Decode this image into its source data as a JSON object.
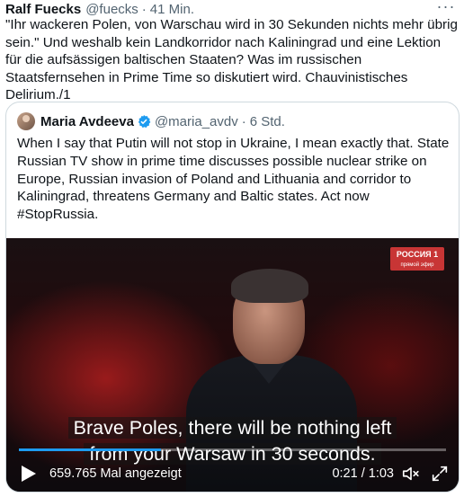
{
  "tweet": {
    "author_name": "Ralf Fuecks",
    "author_handle": "@fuecks",
    "separator": "·",
    "time": "41 Min.",
    "more_icon": "more-horizontal-icon",
    "text": "\"Ihr wackeren Polen, von Warschau wird in 30 Sekunden nichts mehr übrig sein.\" Und weshalb kein Landkorridor nach Kaliningrad und eine Lektion für die aufsässigen baltischen Staaten? Was im russischen Staatsfernsehen in Prime Time so diskutiert wird. Chauvinistisches Delirium./1"
  },
  "quote": {
    "author_name": "Maria Avdeeva",
    "verified_icon": "verified-badge-icon",
    "author_handle": "@maria_avdv",
    "separator": "·",
    "time": "6 Std.",
    "text": "When I say that Putin will not stop in Ukraine, I mean exactly that. State Russian TV show in prime time discusses possible nuclear strike on Europe, Russian invasion of Poland and Lithuania and corridor to Kaliningrad, threatens Germany and Baltic states. Act now #StopRussia."
  },
  "video": {
    "channel_logo": "РОССИЯ 1",
    "channel_sub": "прямой эфир",
    "subtitle_line1": "Brave Poles, there will be nothing left",
    "subtitle_line2": "from your Warsaw in 30 seconds.",
    "views": "659.765 Mal angezeigt",
    "timecode": "0:21 / 1:03",
    "progress": 0.333,
    "accent_color": "#1d9bf0",
    "icons": {
      "play": "play-icon",
      "volume": "volume-off-icon",
      "fullscreen": "fullscreen-icon"
    }
  }
}
